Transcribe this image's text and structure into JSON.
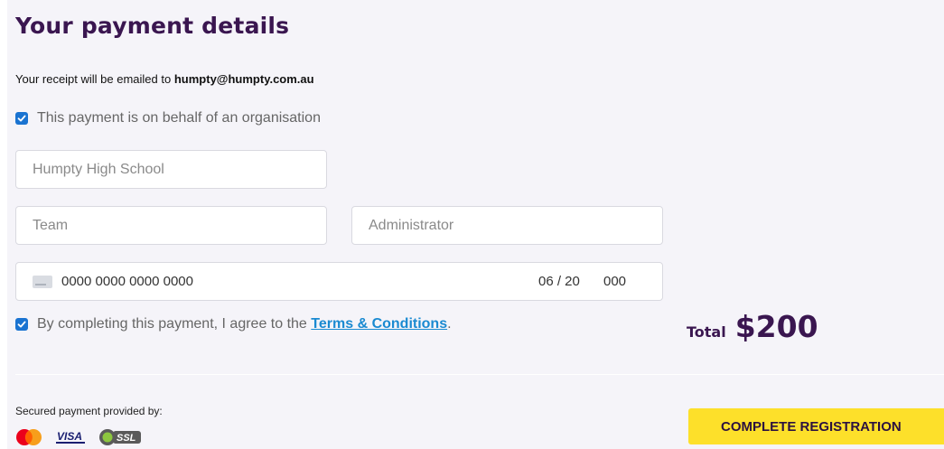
{
  "header": {
    "title": "Your payment details"
  },
  "receipt": {
    "prefix": "Your receipt will be emailed to",
    "email": "humpty@humpty.com.au"
  },
  "organisation": {
    "checkbox_label": "This payment is on behalf of an organisation",
    "checked": true
  },
  "fields": {
    "organisation_name": "Humpty High School",
    "team": "Team",
    "role": "Administrator"
  },
  "card": {
    "number": "0000 0000 0000 0000",
    "expiry": "06 / 20",
    "cvc": "000"
  },
  "terms": {
    "prefix": "By completing this payment, I agree to the",
    "link": "Terms & Conditions",
    "suffix": ".",
    "checked": true
  },
  "total": {
    "label": "Total",
    "amount": "$200"
  },
  "footer": {
    "secured_label": "Secured payment provided by:",
    "providers": [
      "mastercard-icon",
      "visa-icon",
      "ssl-icon"
    ],
    "visa_text": "VISA",
    "ssl_text": "SSL"
  },
  "actions": {
    "complete_label": "COMPLETE REGISTRATION"
  },
  "colors": {
    "title": "#3a1650",
    "checkbox": "#1a73d1",
    "link": "#1a8ad1",
    "button": "#fde02a",
    "background": "#f5f4f9"
  }
}
